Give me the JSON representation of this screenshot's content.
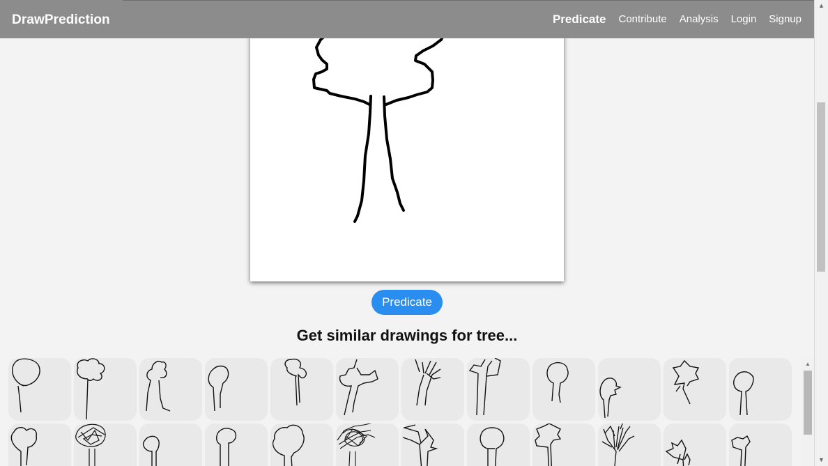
{
  "navbar": {
    "brand": "DrawPrediction",
    "links": [
      "Predicate",
      "Contribute",
      "Analysis",
      "Login",
      "Signup"
    ],
    "active": "Predicate"
  },
  "main": {
    "predict_button": "Predicate",
    "similar_title": "Get similar drawings for tree..."
  },
  "gallery": {
    "item_icon": "tree-sketch",
    "rows": 2,
    "items_per_row": 12
  },
  "colors": {
    "navbar": "#8c8c8c",
    "accent": "#2a8ef0",
    "background": "#f3f3f3",
    "thumbnail": "#e9e9e9"
  }
}
